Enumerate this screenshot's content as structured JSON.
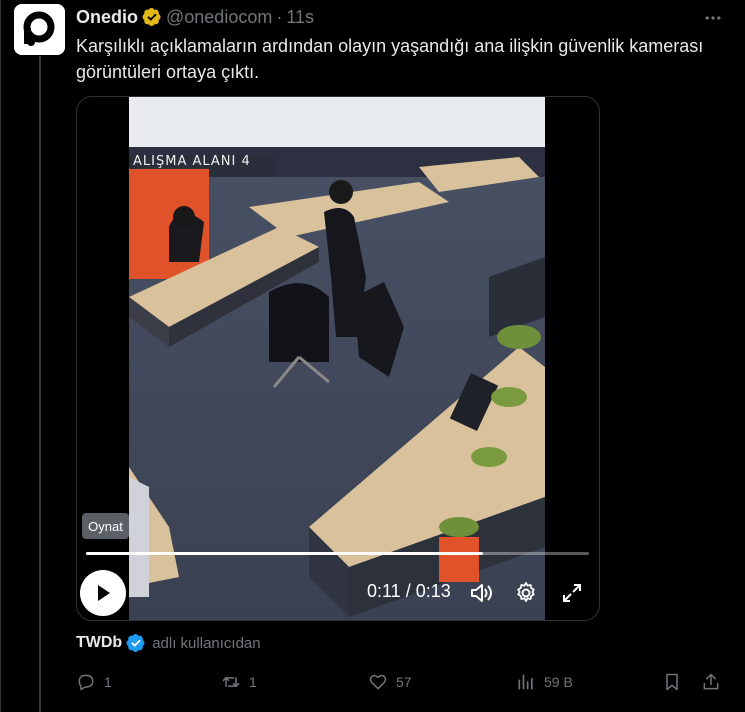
{
  "post": {
    "display_name": "Onedio",
    "handle": "@onediocom",
    "separator": "·",
    "time": "11s",
    "text": "Karşılıklı açıklamaların ardından olayın yaşandığı ana ilişkin güvenlik kamerası görüntüleri ortaya çıktı."
  },
  "video": {
    "overlay_text": "ALIŞMA ALANI 4",
    "tooltip": "Oynat",
    "time_readout": "0:11 / 0:13",
    "progress_fraction": 0.79
  },
  "source": {
    "name": "TWDb",
    "suffix": "adlı kullanıcıdan"
  },
  "actions": {
    "replies": "1",
    "reposts": "1",
    "likes": "57",
    "views": "59 B"
  },
  "colors": {
    "background": "#000000",
    "text_primary": "#e7e9ea",
    "text_secondary": "#71767b",
    "verified_gold": "#e2b719",
    "verified_blue": "#1d9bf0",
    "border": "#2f3336"
  },
  "icons": [
    "onedio-logo",
    "verified-gold-icon",
    "more-icon",
    "play-icon",
    "volume-icon",
    "settings-icon",
    "fullscreen-icon",
    "verified-blue-icon",
    "reply-icon",
    "repost-icon",
    "like-icon",
    "views-icon",
    "bookmark-icon",
    "share-icon"
  ]
}
